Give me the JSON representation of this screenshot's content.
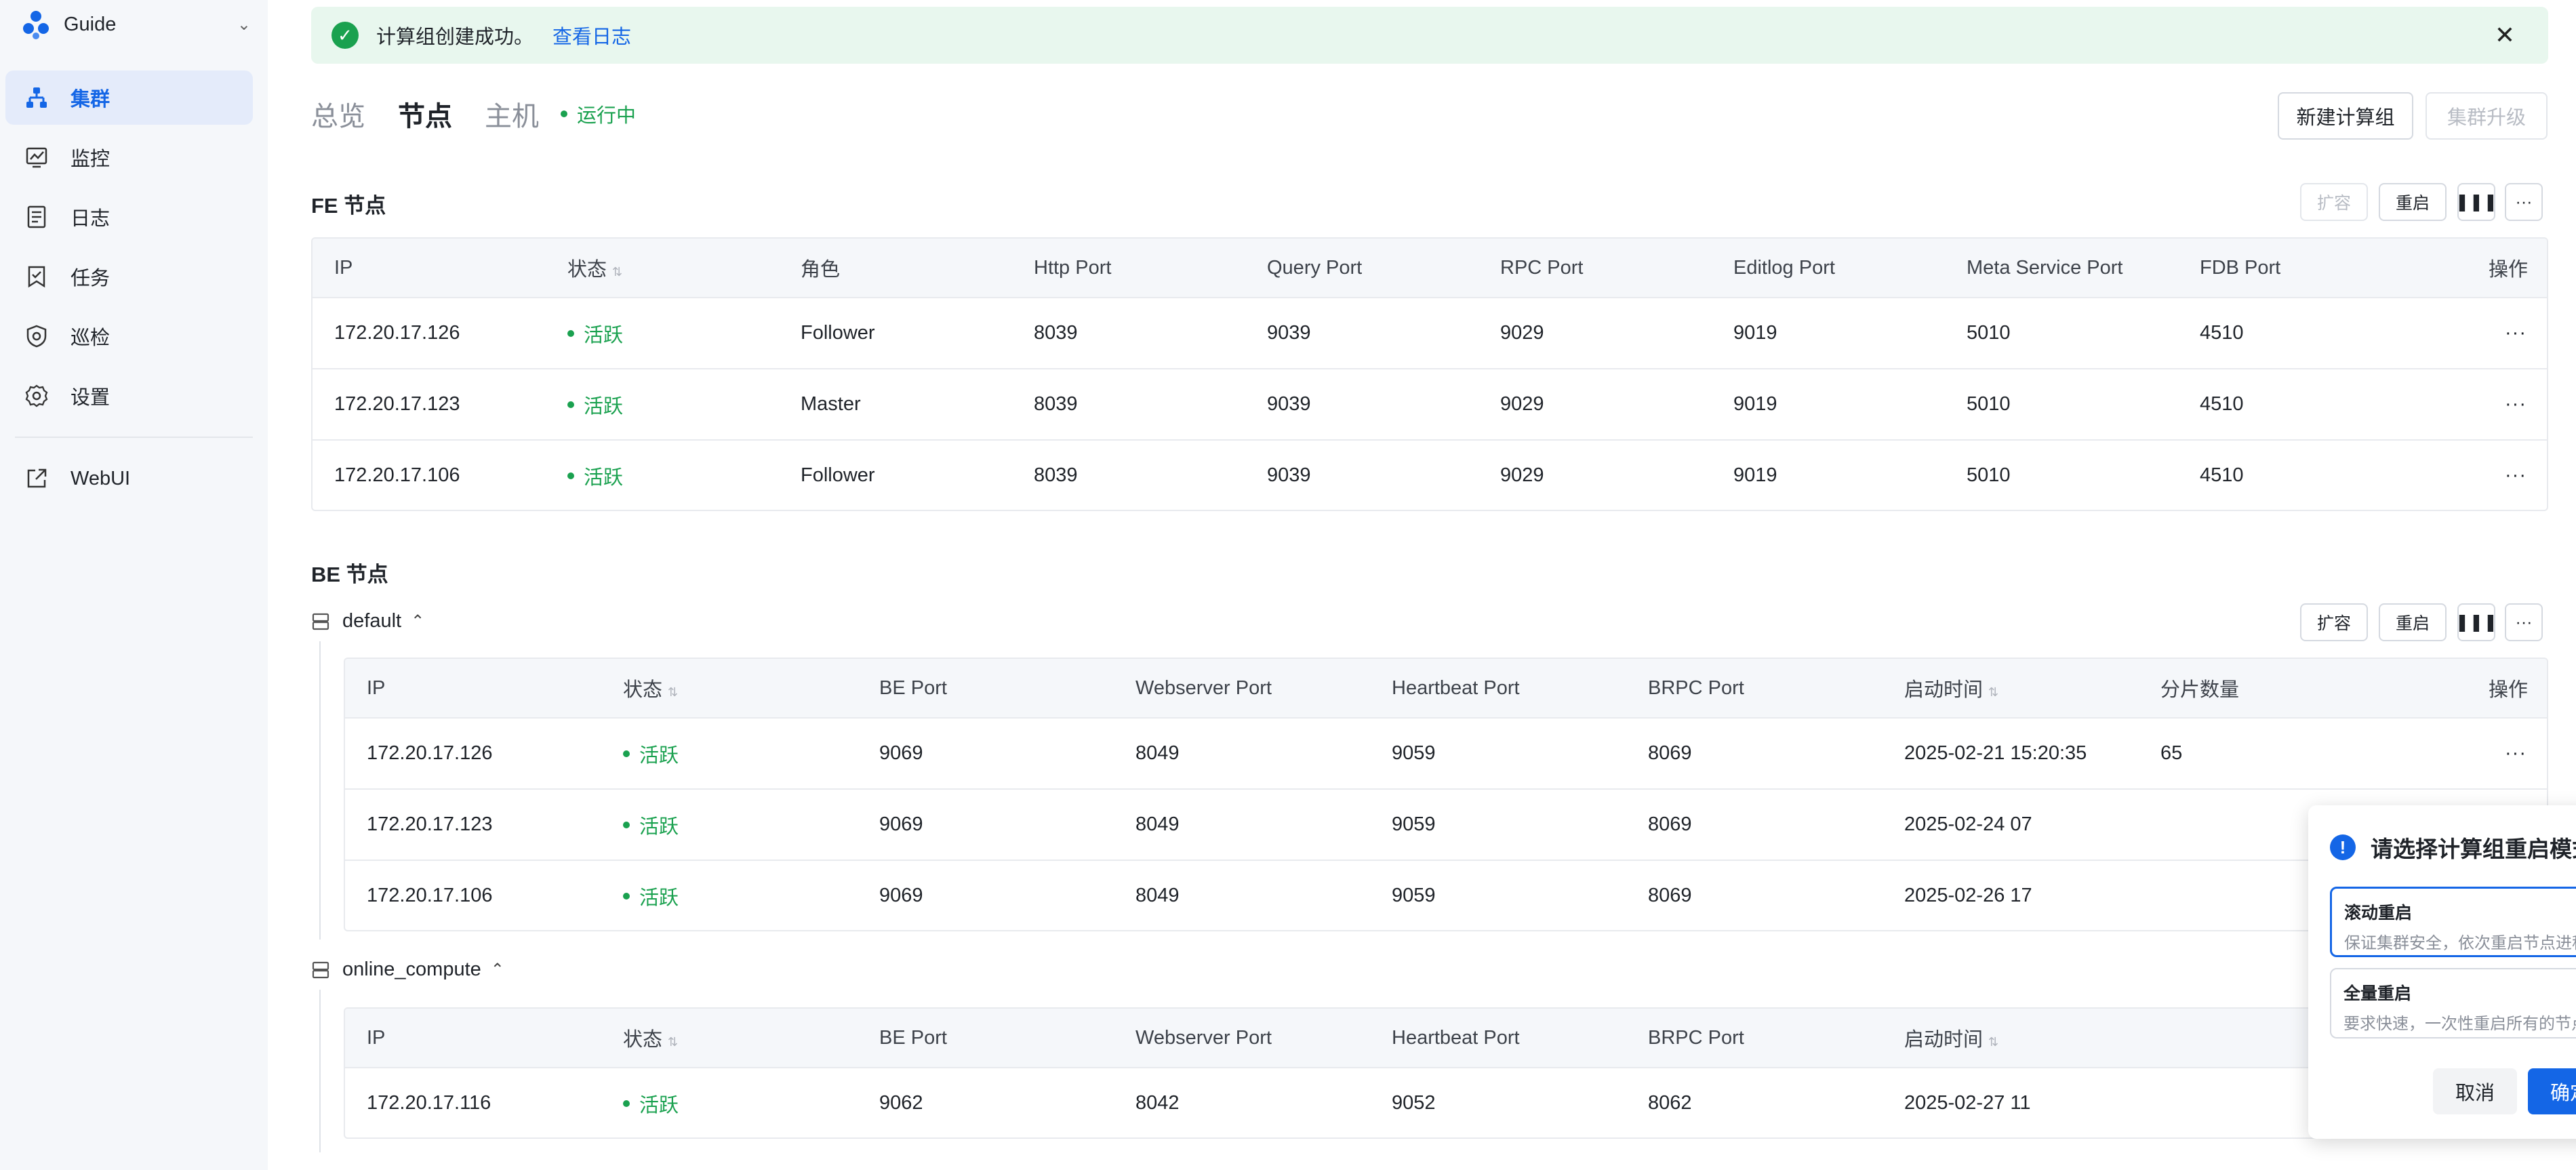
{
  "sidebar": {
    "brand": "Guide",
    "items": [
      {
        "label": "集群",
        "icon": "cluster-icon"
      },
      {
        "label": "监控",
        "icon": "monitor-icon"
      },
      {
        "label": "日志",
        "icon": "log-icon"
      },
      {
        "label": "任务",
        "icon": "task-icon"
      },
      {
        "label": "巡检",
        "icon": "inspect-icon"
      },
      {
        "label": "设置",
        "icon": "gear-icon"
      }
    ],
    "webui": "WebUI"
  },
  "alert": {
    "message": "计算组创建成功。",
    "link": "查看日志"
  },
  "tabs": {
    "overview": "总览",
    "nodes": "节点",
    "hosts": "主机",
    "status": "运行中"
  },
  "header_actions": {
    "new_group": "新建计算组",
    "upgrade": "集群升级"
  },
  "fe": {
    "title": "FE 节点",
    "actions": {
      "scale": "扩容",
      "restart": "重启"
    },
    "columns": [
      "IP",
      "状态",
      "角色",
      "Http Port",
      "Query Port",
      "RPC Port",
      "Editlog Port",
      "Meta Service Port",
      "FDB Port",
      "操作"
    ],
    "rows": [
      {
        "ip": "172.20.17.126",
        "status": "活跃",
        "role": "Follower",
        "http": "8039",
        "query": "9039",
        "rpc": "9029",
        "editlog": "9019",
        "meta": "5010",
        "fdb": "4510",
        "more": "···"
      },
      {
        "ip": "172.20.17.123",
        "status": "活跃",
        "role": "Master",
        "http": "8039",
        "query": "9039",
        "rpc": "9029",
        "editlog": "9019",
        "meta": "5010",
        "fdb": "4510",
        "more": "···"
      },
      {
        "ip": "172.20.17.106",
        "status": "活跃",
        "role": "Follower",
        "http": "8039",
        "query": "9039",
        "rpc": "9029",
        "editlog": "9019",
        "meta": "5010",
        "fdb": "4510",
        "more": "···"
      }
    ]
  },
  "be": {
    "title": "BE 节点",
    "actions": {
      "scale": "扩容",
      "restart": "重启"
    },
    "columns": [
      "IP",
      "状态",
      "BE Port",
      "Webserver Port",
      "Heartbeat Port",
      "BRPC Port",
      "启动时间",
      "分片数量",
      "操作"
    ],
    "groups": [
      {
        "name": "default",
        "rows": [
          {
            "ip": "172.20.17.126",
            "status": "活跃",
            "be": "9069",
            "web": "8049",
            "hb": "9059",
            "brpc": "8069",
            "start": "2025-02-21 15:20:35",
            "tablets": "65",
            "more": "···"
          },
          {
            "ip": "172.20.17.123",
            "status": "活跃",
            "be": "9069",
            "web": "8049",
            "hb": "9059",
            "brpc": "8069",
            "start": "2025-02-24 07",
            "tablets": "",
            "more": "···"
          },
          {
            "ip": "172.20.17.106",
            "status": "活跃",
            "be": "9069",
            "web": "8049",
            "hb": "9059",
            "brpc": "8069",
            "start": "2025-02-26 17",
            "tablets": "",
            "more": "···"
          }
        ]
      },
      {
        "name": "online_compute",
        "rows": [
          {
            "ip": "172.20.17.116",
            "status": "活跃",
            "be": "9062",
            "web": "8042",
            "hb": "9052",
            "brpc": "8062",
            "start": "2025-02-27 11",
            "tablets": "",
            "more": "···"
          }
        ]
      }
    ]
  },
  "popover": {
    "question": "请选择计算组重启模式?",
    "options": [
      {
        "title": "滚动重启",
        "desc": "保证集群安全，依次重启节点进程"
      },
      {
        "title": "全量重启",
        "desc": "要求快速，一次性重启所有的节点"
      }
    ],
    "cancel": "取消",
    "confirm": "确定"
  },
  "colors": {
    "primary": "#1466e6",
    "success": "#1aa14f",
    "highlight": "#e13a3a"
  }
}
